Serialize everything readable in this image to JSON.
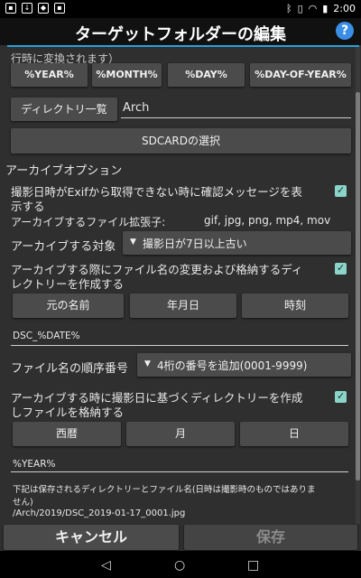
{
  "status": {
    "time": "2:00"
  },
  "header": {
    "title": "ターゲットフォルダーの編集",
    "help_icon": "?"
  },
  "top_partial_text": "行時に変換されます）",
  "format_buttons": [
    "%YEAR%",
    "%MONTH%",
    "%DAY%",
    "%DAY-OF-YEAR%"
  ],
  "directory": {
    "button_label": "ディレクトリ一覧",
    "value": "Arch"
  },
  "sdcard_button": "SDCARDの選択",
  "archive_options": {
    "heading": "アーカイブオプション",
    "exif_confirm_line1": "撮影日時がExifから取得できない時に確認メッセージを表",
    "exif_confirm_line2": "示する",
    "extensions_label": "アーカイブするファイル拡張子:",
    "extensions_value": "gif, jpg, png, mp4, mov",
    "target_label": "アーカイブする対象",
    "target_value": "撮影日が7日以上古い",
    "rename_line1": "アーカイブする際にファイル名の変更および格納するディ",
    "rename_line2": "レクトリーを作成する",
    "name_parts": [
      "元の名前",
      "年月日",
      "時刻"
    ],
    "filename_format": "DSC_%DATE%",
    "sequence_label": "ファイル名の順序番号",
    "sequence_value": "4桁の番号を追加(0001-9999)",
    "dir_by_date_line1": "アーカイブする時に撮影日に基づくディレクトリーを作成",
    "dir_by_date_line2": "しファイルを格納する",
    "date_parts": [
      "西暦",
      "月",
      "日"
    ],
    "dir_format": "%YEAR%",
    "note": "下記は保存されるディレクトリーとファイル名(日時は撮影時のものではありま",
    "note2": "せん)",
    "example_path": "/Arch/2019/DSC_2019-01-17_0001.jpg"
  },
  "footer": {
    "cancel": "キャンセル",
    "save": "保存"
  }
}
